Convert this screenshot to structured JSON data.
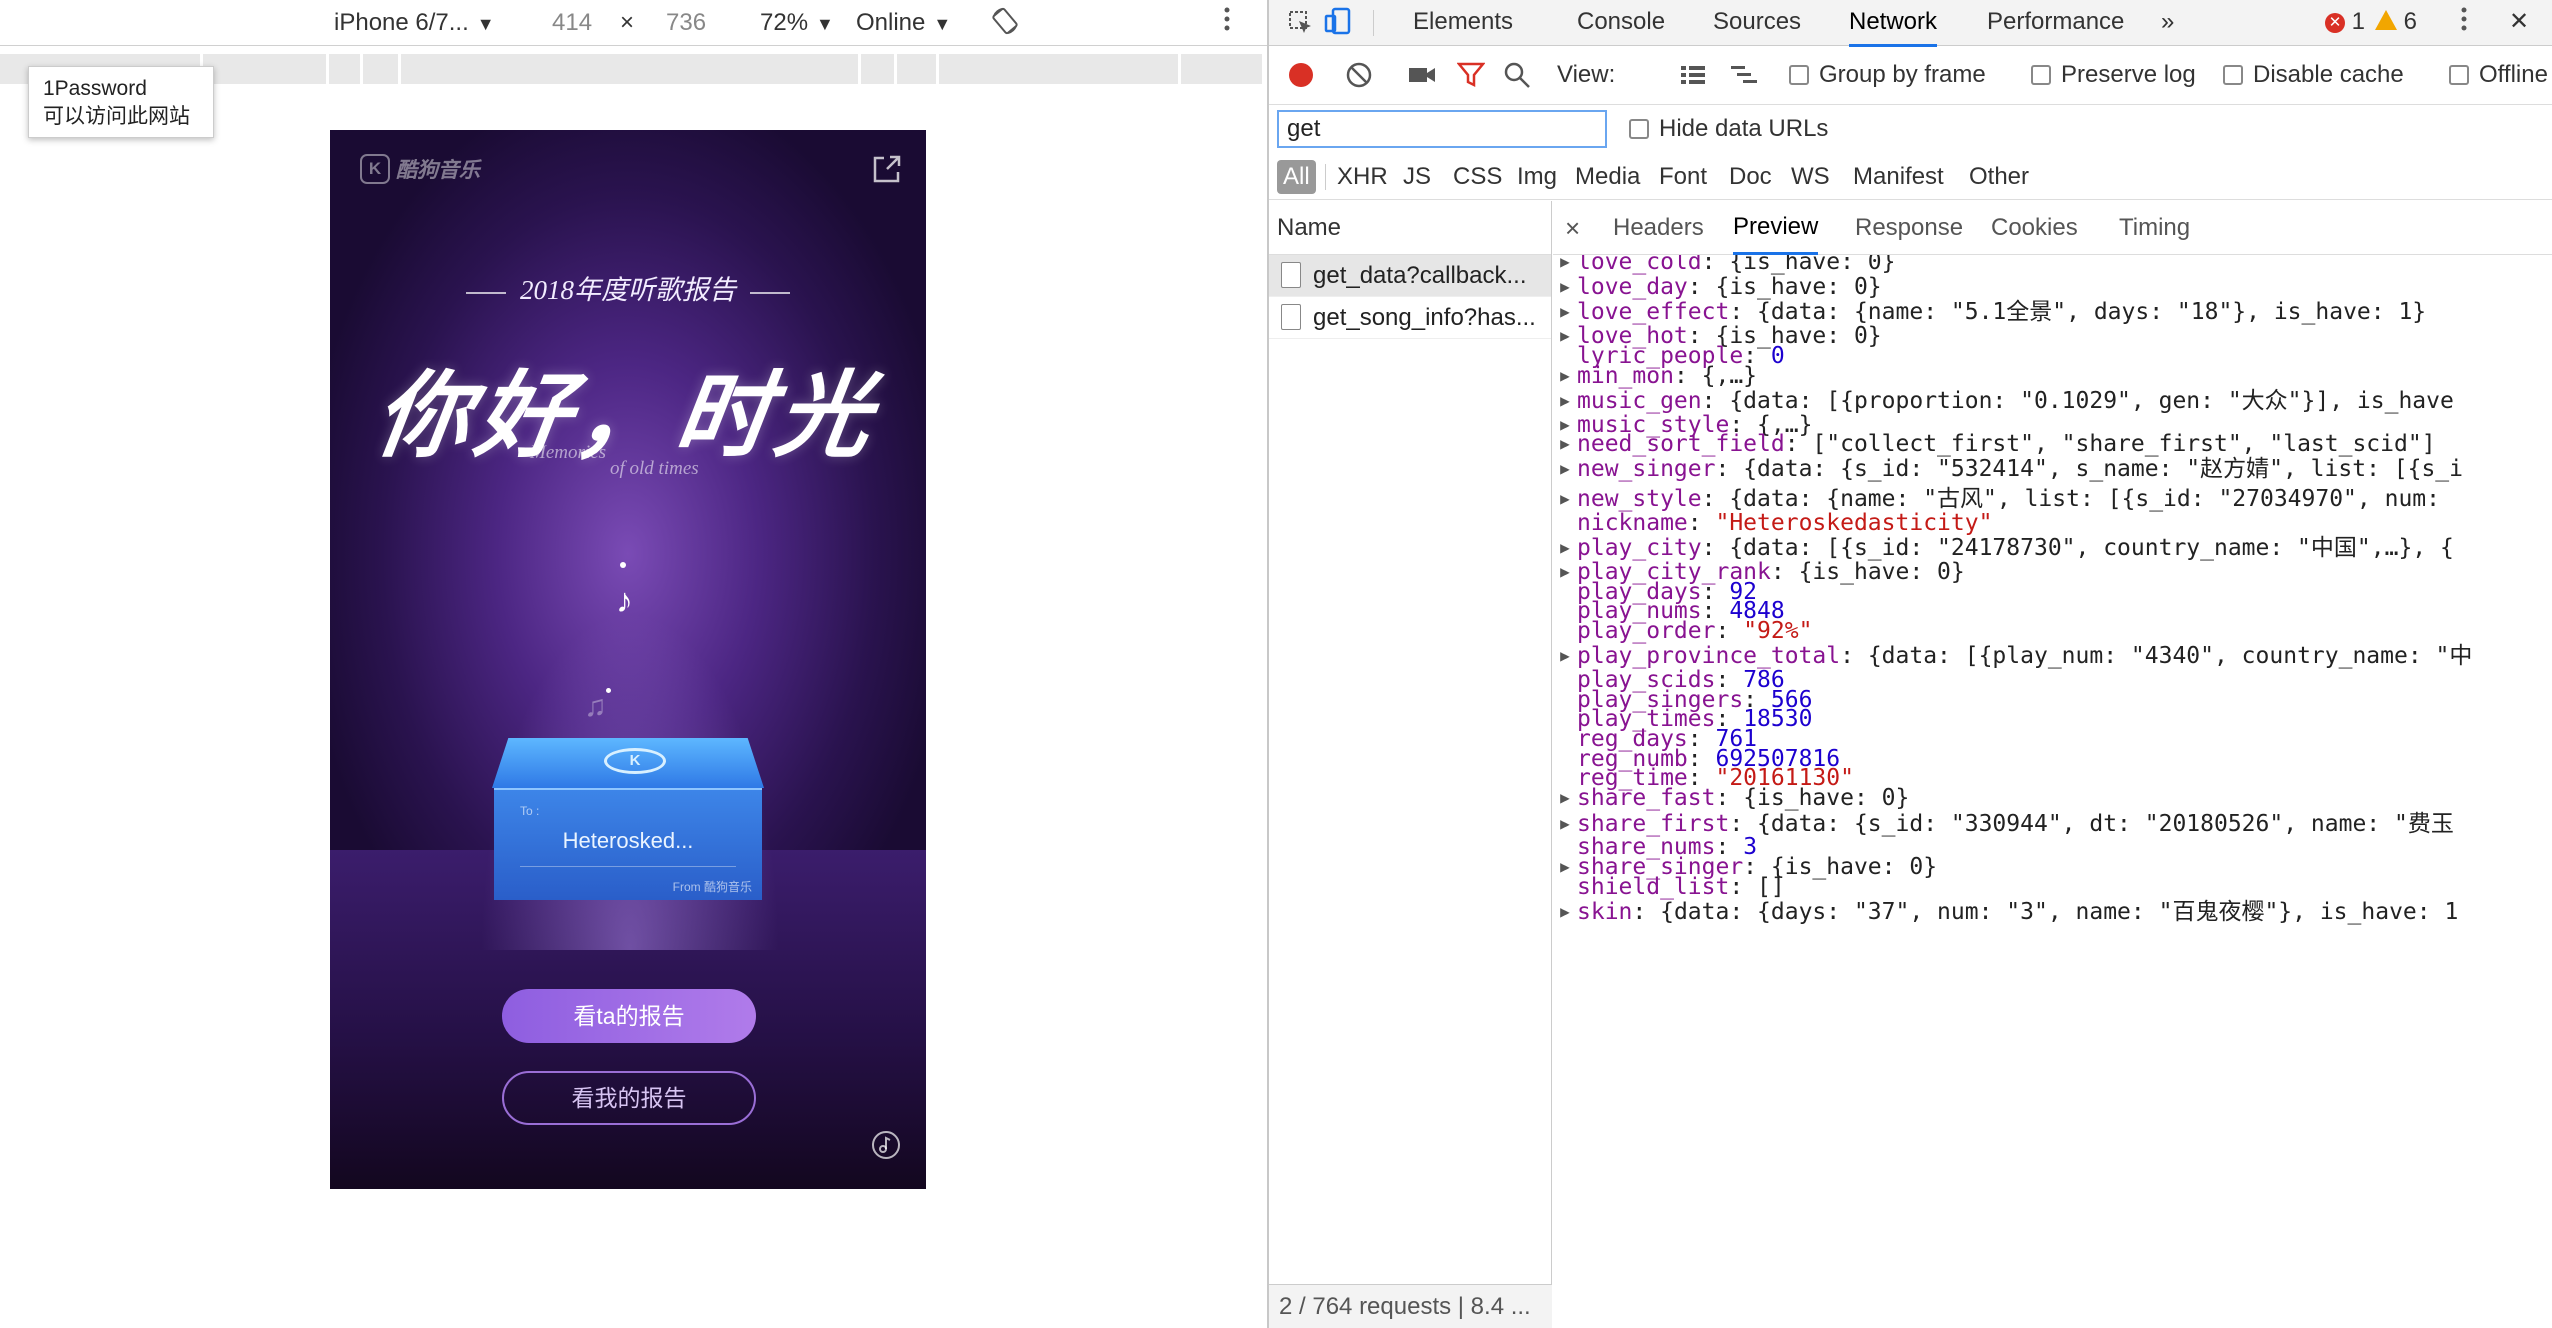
{
  "device_toolbar": {
    "device": "iPhone 6/7...",
    "width": "414",
    "times": "×",
    "height": "736",
    "zoom": "72%",
    "throttle": "Online"
  },
  "tooltip": {
    "line1": "1Password",
    "line2": "可以访问此网站"
  },
  "phone": {
    "brand": "酷狗音乐",
    "report_title": "2018年度听歌报告",
    "hero": "你好，时光",
    "hero_sub1": "Memories",
    "hero_sub2": "of old times",
    "box_to": "To :",
    "box_name": "Heterosked...",
    "box_from": "From 酷狗音乐",
    "btn_ta": "看ta的报告",
    "btn_mine": "看我的报告"
  },
  "devtools": {
    "tabs": [
      "Elements",
      "Console",
      "Sources",
      "Network",
      "Performance"
    ],
    "active_tab": "Network",
    "more": "»",
    "errors": "1",
    "warnings": "6",
    "close": "✕",
    "toolbar": {
      "view_label": "View:",
      "group_by_frame": "Group by frame",
      "preserve_log": "Preserve log",
      "disable_cache": "Disable cache",
      "offline": "Offline"
    },
    "filter_value": "get",
    "hide_data_urls": "Hide data URLs",
    "types": [
      "All",
      "XHR",
      "JS",
      "CSS",
      "Img",
      "Media",
      "Font",
      "Doc",
      "WS",
      "Manifest",
      "Other"
    ],
    "name_header": "Name",
    "requests": [
      "get_data?callback...",
      "get_song_info?has..."
    ],
    "status": "2 / 764 requests | 8.4 ...",
    "detail_close": "×",
    "detail_tabs": [
      "Headers",
      "Preview",
      "Response",
      "Cookies",
      "Timing"
    ],
    "active_detail_tab": "Preview",
    "preview": [
      {
        "expand": true,
        "key": "love_cold",
        "value": "{is_have: 0}",
        "kind": "plain"
      },
      {
        "expand": true,
        "key": "love_day",
        "value": "{is_have: 0}",
        "kind": "plain"
      },
      {
        "expand": true,
        "key": "love_effect",
        "value": "{data: {name: \"5.1全景\", days: \"18\"}, is_have: 1}",
        "kind": "plain"
      },
      {
        "expand": true,
        "key": "love_hot",
        "value": "{is_have: 0}",
        "kind": "plain"
      },
      {
        "expand": false,
        "key": "lyric_people",
        "value": "0",
        "kind": "num"
      },
      {
        "expand": true,
        "key": "min_mon",
        "value": "{,…}",
        "kind": "plain"
      },
      {
        "expand": true,
        "key": "music_gen",
        "value": "{data: [{proportion: \"0.1029\", gen: \"大众\"}], is_have",
        "kind": "plain"
      },
      {
        "expand": true,
        "key": "music_style",
        "value": "{,…}",
        "kind": "plain"
      },
      {
        "expand": true,
        "key": "need_sort_field",
        "value": "[\"collect_first\", \"share_first\", \"last_scid\"]",
        "kind": "plain"
      },
      {
        "expand": true,
        "key": "new_singer",
        "value": "{data: {s_id: \"532414\", s_name: \"赵方婧\", list: [{s_i",
        "kind": "plain"
      },
      {
        "expand": true,
        "key": "new_style",
        "value": "{data: {name: \"古风\", list: [{s_id: \"27034970\", num: ",
        "kind": "plain"
      },
      {
        "expand": false,
        "key": "nickname",
        "value": "\"Heteroskedasticity\"",
        "kind": "str"
      },
      {
        "expand": true,
        "key": "play_city",
        "value": "{data: [{s_id: \"24178730\", country_name: \"中国\",…}, {",
        "kind": "plain"
      },
      {
        "expand": true,
        "key": "play_city_rank",
        "value": "{is_have: 0}",
        "kind": "plain"
      },
      {
        "expand": false,
        "key": "play_days",
        "value": "92",
        "kind": "num"
      },
      {
        "expand": false,
        "key": "play_nums",
        "value": "4848",
        "kind": "num"
      },
      {
        "expand": false,
        "key": "play_order",
        "value": "\"92%\"",
        "kind": "str"
      },
      {
        "expand": true,
        "key": "play_province_total",
        "value": "{data: [{play_num: \"4340\", country_name: \"中",
        "kind": "plain"
      },
      {
        "expand": false,
        "key": "play_scids",
        "value": "786",
        "kind": "num"
      },
      {
        "expand": false,
        "key": "play_singers",
        "value": "566",
        "kind": "num"
      },
      {
        "expand": false,
        "key": "play_times",
        "value": "18530",
        "kind": "num"
      },
      {
        "expand": false,
        "key": "reg_days",
        "value": "761",
        "kind": "num"
      },
      {
        "expand": false,
        "key": "reg_numb",
        "value": "692507816",
        "kind": "num"
      },
      {
        "expand": false,
        "key": "reg_time",
        "value": "\"20161130\"",
        "kind": "str"
      },
      {
        "expand": true,
        "key": "share_fast",
        "value": "{is_have: 0}",
        "kind": "plain"
      },
      {
        "expand": true,
        "key": "share_first",
        "value": "{data: {s_id: \"330944\", dt: \"20180526\", name: \"费玉",
        "kind": "plain"
      },
      {
        "expand": false,
        "key": "share_nums",
        "value": "3",
        "kind": "num"
      },
      {
        "expand": true,
        "key": "share_singer",
        "value": "{is_have: 0}",
        "kind": "plain"
      },
      {
        "expand": false,
        "key": "shield_list",
        "value": "[]",
        "kind": "plain"
      },
      {
        "expand": true,
        "key": "skin",
        "value": "{data: {days: \"37\", num: \"3\", name: \"百鬼夜樱\"}, is_have: 1",
        "kind": "plain"
      }
    ]
  },
  "colors": {
    "accent": "#1a73e8",
    "json_key": "#881391",
    "json_number": "#1c00cf",
    "json_string": "#c41a16",
    "phone_bg": "#3a1a6b",
    "button_purple": "#9a6ed6",
    "box_blue": "#3d85e8"
  },
  "icons": [
    "inspect-icon",
    "device-toggle-icon",
    "rotate-icon",
    "more-vert-icon",
    "record-icon",
    "clear-icon",
    "camera-icon",
    "filter-icon",
    "search-icon",
    "list-view-icon",
    "waterfall-view-icon",
    "share-icon",
    "music-icon",
    "music-note-icon",
    "kugou-logo-icon"
  ]
}
